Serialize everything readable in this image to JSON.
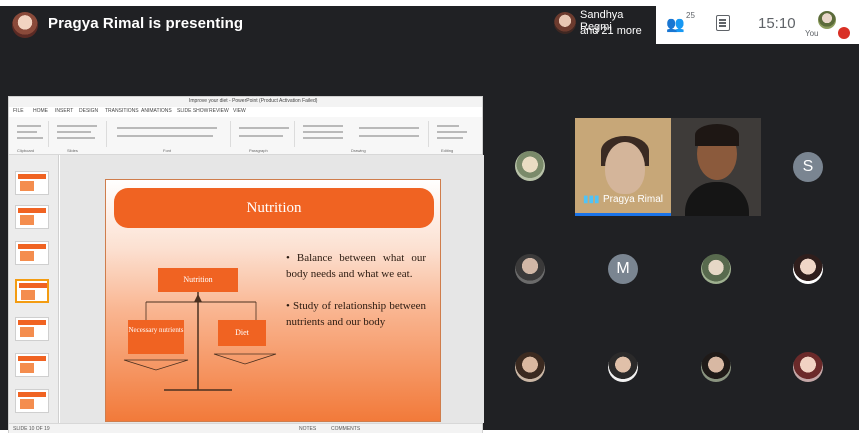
{
  "meeting": {
    "presenting_text": "Pragya Rimal is presenting",
    "top_right": {
      "participant_name": "Sandhya Regmi",
      "participant_more": "and 21 more",
      "people_count": "25",
      "time": "15:10",
      "you_label": "You"
    },
    "camera_tiles": {
      "presenter_name": "Pragya Rimal"
    },
    "participants": {
      "letter_s": "S",
      "letter_m": "M"
    }
  },
  "powerpoint": {
    "window_title": "Improve your diet - PowerPoint (Product Activation Failed)",
    "menu": [
      "FILE",
      "HOME",
      "INSERT",
      "DESIGN",
      "TRANSITIONS",
      "ANIMATIONS",
      "SLIDE SHOW",
      "REVIEW",
      "VIEW"
    ],
    "ribbon_groups": [
      "Clipboard",
      "Slides",
      "Font",
      "Paragraph",
      "Drawing",
      "Editing"
    ],
    "status": {
      "left": "SLIDE 10 OF 19",
      "notes": "NOTES",
      "comments": "COMMENTS"
    },
    "slide": {
      "title": "Nutrition",
      "diagram_top": "Nutrition",
      "diagram_left": "Necessary nutrients",
      "diagram_right": "Diet",
      "bullets": [
        "Balance between what our body needs and what we eat.",
        "Study of relationship between nutrients and our body"
      ]
    }
  },
  "colors": {
    "accent_orange": "#f06322",
    "meeting_bg": "#202124",
    "mic_off": "#d93025",
    "speaking_blue": "#1a73e8"
  }
}
